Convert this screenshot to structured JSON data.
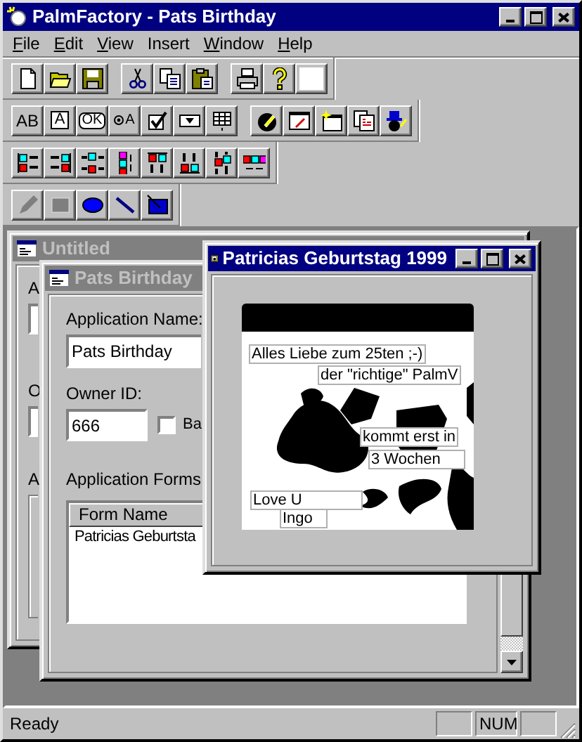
{
  "window": {
    "title": "PalmFactory - Pats Birthday"
  },
  "menu": [
    {
      "label": "File",
      "underlined": true
    },
    {
      "label": "Edit",
      "underlined": true
    },
    {
      "label": "View",
      "underlined": true
    },
    {
      "label": "Insert",
      "underlined": false
    },
    {
      "label": "Window",
      "underlined": true
    },
    {
      "label": "Help",
      "underlined": true
    }
  ],
  "toolbars": [
    [
      [
        {
          "kind": "new"
        },
        {
          "kind": "open"
        },
        {
          "kind": "save"
        }
      ],
      [
        {
          "kind": "cut"
        },
        {
          "kind": "copy"
        },
        {
          "kind": "paste"
        }
      ],
      [
        {
          "kind": "print"
        },
        {
          "kind": "help"
        },
        {
          "kind": "color"
        }
      ]
    ],
    [
      [
        {
          "kind": "text",
          "label": "AB"
        },
        {
          "kind": "boxed",
          "label": "A"
        },
        {
          "kind": "rounded",
          "label": "OK"
        },
        {
          "kind": "radio",
          "label": "A"
        },
        {
          "kind": "checkbox"
        },
        {
          "kind": "dropdown"
        },
        {
          "kind": "table"
        }
      ],
      [
        {
          "kind": "properties"
        },
        {
          "kind": "editform"
        },
        {
          "kind": "newform"
        },
        {
          "kind": "copyform"
        },
        {
          "kind": "wizard"
        }
      ]
    ],
    [
      [
        {
          "kind": "align-left"
        },
        {
          "kind": "align-right"
        },
        {
          "kind": "center-horizontal"
        },
        {
          "kind": "space-vertical"
        },
        {
          "kind": "align-top"
        },
        {
          "kind": "align-bottom"
        },
        {
          "kind": "center-vertical"
        },
        {
          "kind": "space-horizontal"
        }
      ]
    ],
    [
      [
        {
          "kind": "pencil",
          "disabled": true
        },
        {
          "kind": "rectangle",
          "disabled": true
        },
        {
          "kind": "ellipse",
          "disabled": false
        },
        {
          "kind": "line",
          "disabled": false
        },
        {
          "kind": "bitmap",
          "disabled": false
        }
      ]
    ]
  ],
  "documents": [
    {
      "kind": "app",
      "title": "Untitled",
      "active": false,
      "letters": [
        "A",
        "O",
        "A"
      ]
    },
    {
      "kind": "settings",
      "title": "Pats Birthday",
      "active": false,
      "app_name_label": "Application Name:",
      "app_name": "Pats Birthday",
      "owner_label": "Owner ID:",
      "owner_id": "666",
      "checkbox": {
        "label": "Ba",
        "checked": false
      },
      "forms_label": "Application Forms",
      "forms_table": {
        "columns": [
          "Form Name"
        ],
        "rows": [
          [
            "Patricias Geburtsta"
          ]
        ]
      }
    },
    {
      "kind": "form",
      "title": "Patricias Geburtstag 1999",
      "active": true,
      "labels": [
        "Alles Liebe zum 25ten ;-)",
        "der \"richtige\" PalmV",
        "kommt erst in",
        "3 Wochen",
        "Love U",
        "Ingo"
      ]
    }
  ],
  "status_bar": {
    "text": "Ready",
    "indicators": [
      "NUM"
    ]
  }
}
